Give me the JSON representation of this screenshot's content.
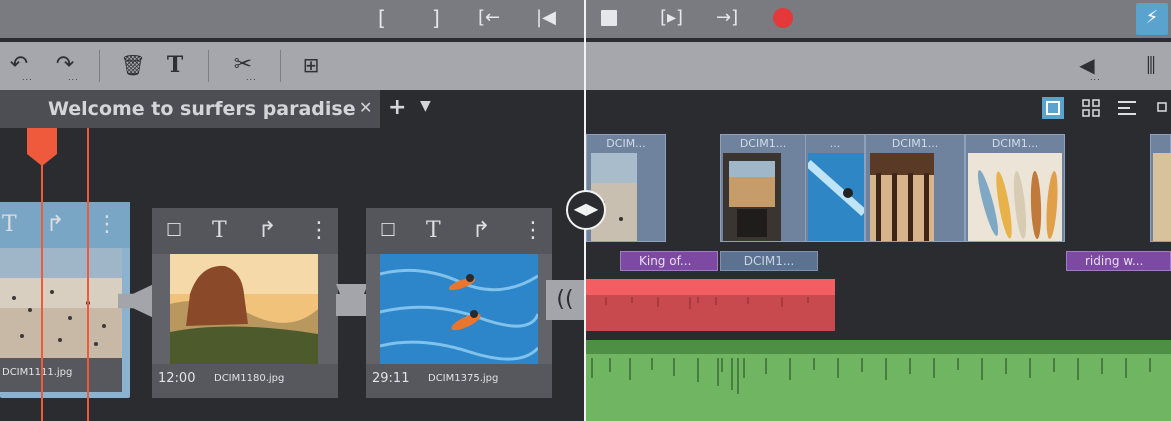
{
  "transport": {
    "icons": [
      "mark-in-icon",
      "mark-out-icon",
      "go-to-in-icon",
      "go-to-start-icon",
      "stop-icon",
      "play-selection-icon",
      "go-to-out-icon",
      "record-icon",
      "flash-icon"
    ],
    "record_color": "#e4383a",
    "accent_color": "#5aa3cf"
  },
  "toolbar": {
    "icons": [
      "undo-icon",
      "redo-icon",
      "delete-icon",
      "title-icon",
      "cut-icon",
      "insert-icon",
      "volume-icon",
      "mixer-icon"
    ]
  },
  "tabs": {
    "active": "Welcome to surfers paradise"
  },
  "storyboard": {
    "cards": [
      {
        "time": "",
        "file": "DCIM1111.jpg"
      },
      {
        "time": "12:00",
        "file": "DCIM1180.jpg"
      },
      {
        "time": "29:11",
        "file": "DCIM1375.jpg"
      }
    ]
  },
  "timeline": {
    "clips": [
      {
        "label": "DCIM..."
      },
      {
        "label": "DCIM1..."
      },
      {
        "label": "..."
      },
      {
        "label": "DCIM1..."
      },
      {
        "label": "DCIM1..."
      }
    ],
    "titles": [
      {
        "label": "King of..."
      },
      {
        "label": "DCIM1..."
      },
      {
        "label": "riding w..."
      }
    ]
  },
  "colors": {
    "playhead": "#ef5a3c",
    "title_track": "#7c4aa3",
    "audio_red": "#c94a4e",
    "audio_green": "#6fb562"
  }
}
